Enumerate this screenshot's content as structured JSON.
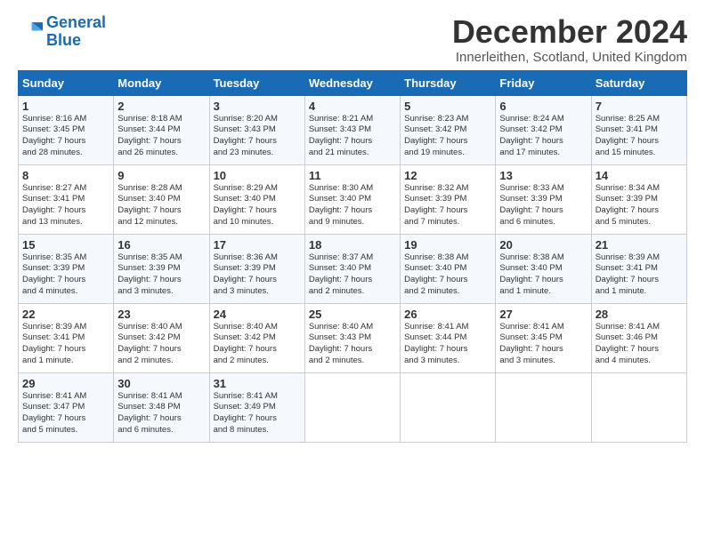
{
  "logo": {
    "line1": "General",
    "line2": "Blue"
  },
  "title": "December 2024",
  "subtitle": "Innerleithen, Scotland, United Kingdom",
  "days_header": [
    "Sunday",
    "Monday",
    "Tuesday",
    "Wednesday",
    "Thursday",
    "Friday",
    "Saturday"
  ],
  "weeks": [
    [
      {
        "day": "1",
        "lines": [
          "Sunrise: 8:16 AM",
          "Sunset: 3:45 PM",
          "Daylight: 7 hours",
          "and 28 minutes."
        ]
      },
      {
        "day": "2",
        "lines": [
          "Sunrise: 8:18 AM",
          "Sunset: 3:44 PM",
          "Daylight: 7 hours",
          "and 26 minutes."
        ]
      },
      {
        "day": "3",
        "lines": [
          "Sunrise: 8:20 AM",
          "Sunset: 3:43 PM",
          "Daylight: 7 hours",
          "and 23 minutes."
        ]
      },
      {
        "day": "4",
        "lines": [
          "Sunrise: 8:21 AM",
          "Sunset: 3:43 PM",
          "Daylight: 7 hours",
          "and 21 minutes."
        ]
      },
      {
        "day": "5",
        "lines": [
          "Sunrise: 8:23 AM",
          "Sunset: 3:42 PM",
          "Daylight: 7 hours",
          "and 19 minutes."
        ]
      },
      {
        "day": "6",
        "lines": [
          "Sunrise: 8:24 AM",
          "Sunset: 3:42 PM",
          "Daylight: 7 hours",
          "and 17 minutes."
        ]
      },
      {
        "day": "7",
        "lines": [
          "Sunrise: 8:25 AM",
          "Sunset: 3:41 PM",
          "Daylight: 7 hours",
          "and 15 minutes."
        ]
      }
    ],
    [
      {
        "day": "8",
        "lines": [
          "Sunrise: 8:27 AM",
          "Sunset: 3:41 PM",
          "Daylight: 7 hours",
          "and 13 minutes."
        ]
      },
      {
        "day": "9",
        "lines": [
          "Sunrise: 8:28 AM",
          "Sunset: 3:40 PM",
          "Daylight: 7 hours",
          "and 12 minutes."
        ]
      },
      {
        "day": "10",
        "lines": [
          "Sunrise: 8:29 AM",
          "Sunset: 3:40 PM",
          "Daylight: 7 hours",
          "and 10 minutes."
        ]
      },
      {
        "day": "11",
        "lines": [
          "Sunrise: 8:30 AM",
          "Sunset: 3:40 PM",
          "Daylight: 7 hours",
          "and 9 minutes."
        ]
      },
      {
        "day": "12",
        "lines": [
          "Sunrise: 8:32 AM",
          "Sunset: 3:39 PM",
          "Daylight: 7 hours",
          "and 7 minutes."
        ]
      },
      {
        "day": "13",
        "lines": [
          "Sunrise: 8:33 AM",
          "Sunset: 3:39 PM",
          "Daylight: 7 hours",
          "and 6 minutes."
        ]
      },
      {
        "day": "14",
        "lines": [
          "Sunrise: 8:34 AM",
          "Sunset: 3:39 PM",
          "Daylight: 7 hours",
          "and 5 minutes."
        ]
      }
    ],
    [
      {
        "day": "15",
        "lines": [
          "Sunrise: 8:35 AM",
          "Sunset: 3:39 PM",
          "Daylight: 7 hours",
          "and 4 minutes."
        ]
      },
      {
        "day": "16",
        "lines": [
          "Sunrise: 8:35 AM",
          "Sunset: 3:39 PM",
          "Daylight: 7 hours",
          "and 3 minutes."
        ]
      },
      {
        "day": "17",
        "lines": [
          "Sunrise: 8:36 AM",
          "Sunset: 3:39 PM",
          "Daylight: 7 hours",
          "and 3 minutes."
        ]
      },
      {
        "day": "18",
        "lines": [
          "Sunrise: 8:37 AM",
          "Sunset: 3:40 PM",
          "Daylight: 7 hours",
          "and 2 minutes."
        ]
      },
      {
        "day": "19",
        "lines": [
          "Sunrise: 8:38 AM",
          "Sunset: 3:40 PM",
          "Daylight: 7 hours",
          "and 2 minutes."
        ]
      },
      {
        "day": "20",
        "lines": [
          "Sunrise: 8:38 AM",
          "Sunset: 3:40 PM",
          "Daylight: 7 hours",
          "and 1 minute."
        ]
      },
      {
        "day": "21",
        "lines": [
          "Sunrise: 8:39 AM",
          "Sunset: 3:41 PM",
          "Daylight: 7 hours",
          "and 1 minute."
        ]
      }
    ],
    [
      {
        "day": "22",
        "lines": [
          "Sunrise: 8:39 AM",
          "Sunset: 3:41 PM",
          "Daylight: 7 hours",
          "and 1 minute."
        ]
      },
      {
        "day": "23",
        "lines": [
          "Sunrise: 8:40 AM",
          "Sunset: 3:42 PM",
          "Daylight: 7 hours",
          "and 2 minutes."
        ]
      },
      {
        "day": "24",
        "lines": [
          "Sunrise: 8:40 AM",
          "Sunset: 3:42 PM",
          "Daylight: 7 hours",
          "and 2 minutes."
        ]
      },
      {
        "day": "25",
        "lines": [
          "Sunrise: 8:40 AM",
          "Sunset: 3:43 PM",
          "Daylight: 7 hours",
          "and 2 minutes."
        ]
      },
      {
        "day": "26",
        "lines": [
          "Sunrise: 8:41 AM",
          "Sunset: 3:44 PM",
          "Daylight: 7 hours",
          "and 3 minutes."
        ]
      },
      {
        "day": "27",
        "lines": [
          "Sunrise: 8:41 AM",
          "Sunset: 3:45 PM",
          "Daylight: 7 hours",
          "and 3 minutes."
        ]
      },
      {
        "day": "28",
        "lines": [
          "Sunrise: 8:41 AM",
          "Sunset: 3:46 PM",
          "Daylight: 7 hours",
          "and 4 minutes."
        ]
      }
    ],
    [
      {
        "day": "29",
        "lines": [
          "Sunrise: 8:41 AM",
          "Sunset: 3:47 PM",
          "Daylight: 7 hours",
          "and 5 minutes."
        ]
      },
      {
        "day": "30",
        "lines": [
          "Sunrise: 8:41 AM",
          "Sunset: 3:48 PM",
          "Daylight: 7 hours",
          "and 6 minutes."
        ]
      },
      {
        "day": "31",
        "lines": [
          "Sunrise: 8:41 AM",
          "Sunset: 3:49 PM",
          "Daylight: 7 hours",
          "and 8 minutes."
        ]
      },
      null,
      null,
      null,
      null
    ]
  ]
}
